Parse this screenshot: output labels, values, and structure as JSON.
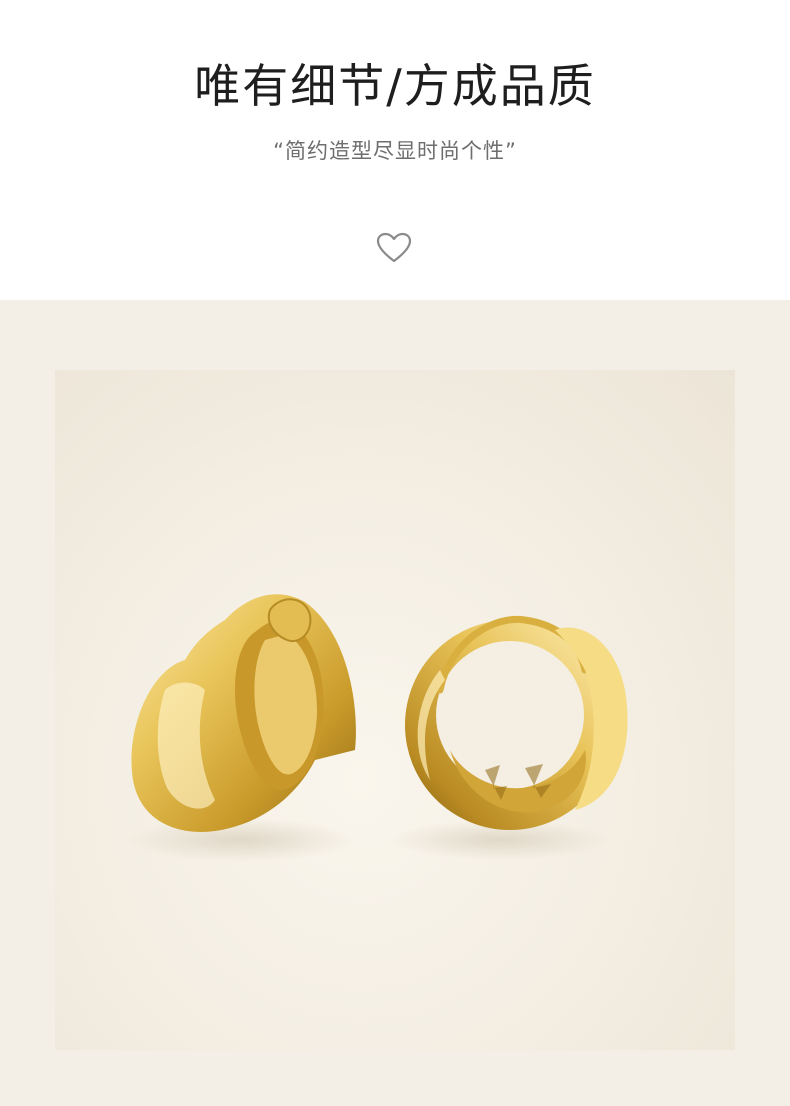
{
  "header": {
    "title": "唯有细节/方成品质",
    "subtitle": "“简约造型尽显时尚个性”",
    "divider_icon": "heart-outline-icon"
  },
  "product_image": {
    "subject": "gold-hoop-earrings"
  },
  "colors": {
    "page_background": "#ffffff",
    "photo_background": "#f3efe7",
    "gold": "#d9b040",
    "title_text": "#1e1e1e",
    "subtitle_text": "#6e6e6e"
  }
}
